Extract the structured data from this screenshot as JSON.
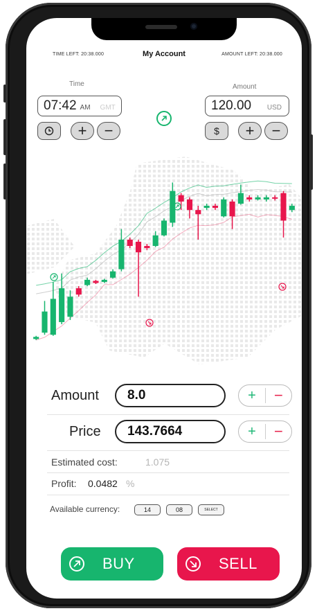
{
  "header": {
    "time_left": "TIME LEFT: 20:38.000",
    "title": "My Account",
    "amount_left": "AMOUNT LEFT: 20:38.000"
  },
  "time_control": {
    "label": "Time",
    "value": "07:42",
    "unit": "AM",
    "faint_unit": "GMT"
  },
  "amount_control": {
    "label": "Amount",
    "value": "120.00",
    "unit": "USD",
    "currency_symbol": "$"
  },
  "trade": {
    "amount_label": "Amount",
    "amount_value": "8.0",
    "price_label": "Price",
    "price_value": "143.7664",
    "plus": "+",
    "minus": "−"
  },
  "info": {
    "estimated_cost_label": "Estimated cost:",
    "estimated_cost_value": "1.075",
    "profit_label": "Profit:",
    "profit_value": "0.0482",
    "profit_unit": "%",
    "available_currency_label": "Available currency:",
    "currency_a": "14",
    "currency_b": "08",
    "select_label": "SELECT"
  },
  "actions": {
    "buy_label": "BUY",
    "sell_label": "SELL"
  },
  "colors": {
    "up": "#17b56e",
    "down": "#e8164c"
  },
  "chart_data": {
    "type": "candlestick",
    "candles": [
      {
        "o": 24,
        "c": 26,
        "h": 27,
        "l": 23
      },
      {
        "o": 30,
        "c": 50,
        "h": 60,
        "l": 28
      },
      {
        "o": 28,
        "c": 62,
        "h": 78,
        "l": 27
      },
      {
        "o": 40,
        "c": 72,
        "h": 86,
        "l": 38
      },
      {
        "o": 45,
        "c": 64,
        "h": 70,
        "l": 42
      },
      {
        "o": 72,
        "c": 66,
        "h": 74,
        "l": 64
      },
      {
        "o": 75,
        "c": 80,
        "h": 82,
        "l": 74
      },
      {
        "o": 79,
        "c": 77,
        "h": 80,
        "l": 76
      },
      {
        "o": 78,
        "c": 80,
        "h": 81,
        "l": 77
      },
      {
        "o": 82,
        "c": 88,
        "h": 90,
        "l": 81
      },
      {
        "o": 90,
        "c": 118,
        "h": 128,
        "l": 88
      },
      {
        "o": 118,
        "c": 112,
        "h": 120,
        "l": 110
      },
      {
        "o": 116,
        "c": 106,
        "h": 118,
        "l": 64
      },
      {
        "o": 112,
        "c": 110,
        "h": 114,
        "l": 108
      },
      {
        "o": 112,
        "c": 122,
        "h": 126,
        "l": 111
      },
      {
        "o": 122,
        "c": 136,
        "h": 138,
        "l": 121
      },
      {
        "o": 134,
        "c": 164,
        "h": 172,
        "l": 130
      },
      {
        "o": 160,
        "c": 154,
        "h": 162,
        "l": 146
      },
      {
        "o": 156,
        "c": 146,
        "h": 158,
        "l": 138
      },
      {
        "o": 146,
        "c": 142,
        "h": 150,
        "l": 118
      },
      {
        "o": 148,
        "c": 150,
        "h": 152,
        "l": 146
      },
      {
        "o": 150,
        "c": 148,
        "h": 152,
        "l": 146
      },
      {
        "o": 140,
        "c": 156,
        "h": 158,
        "l": 139
      },
      {
        "o": 154,
        "c": 140,
        "h": 156,
        "l": 128
      },
      {
        "o": 152,
        "c": 162,
        "h": 170,
        "l": 151
      },
      {
        "o": 158,
        "c": 156,
        "h": 160,
        "l": 154
      },
      {
        "o": 156,
        "c": 158,
        "h": 160,
        "l": 155
      },
      {
        "o": 156,
        "c": 158,
        "h": 160,
        "l": 154
      },
      {
        "o": 158,
        "c": 157,
        "h": 160,
        "l": 155
      },
      {
        "o": 162,
        "c": 136,
        "h": 164,
        "l": 120
      },
      {
        "o": 146,
        "c": 150,
        "h": 152,
        "l": 144
      }
    ]
  }
}
